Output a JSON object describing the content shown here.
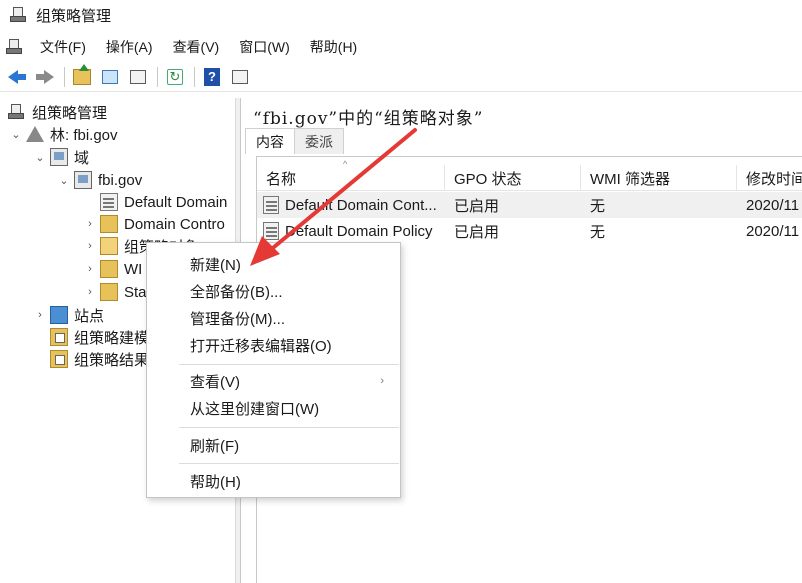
{
  "window": {
    "title": "组策略管理",
    "icon": "mmc-console-icon"
  },
  "menubar": {
    "items": [
      "文件(F)",
      "操作(A)",
      "查看(V)",
      "窗口(W)",
      "帮助(H)"
    ]
  },
  "toolbar": {
    "icons": [
      "back-icon",
      "forward-icon",
      "up-folder-icon",
      "show-hide-tree-icon",
      "properties-icon",
      "refresh-icon",
      "help-icon",
      "action-pane-icon"
    ]
  },
  "tree": {
    "root": "组策略管理",
    "forest": "林: fbi.gov",
    "domains": "域",
    "domain": "fbi.gov",
    "children": [
      "Default Domain",
      "Domain Contro",
      "组策略对象",
      "WI",
      "Sta"
    ],
    "sites": "站点",
    "modeling": "组策略建模",
    "results": "组策略结果"
  },
  "main": {
    "title": "“fbi.gov”中的“组策略对象”",
    "tabs": [
      "内容",
      "委派"
    ],
    "columns": [
      "名称",
      "GPO 状态",
      "WMI 筛选器",
      "修改时间"
    ],
    "rows": [
      {
        "name": "Default Domain Cont...",
        "status": "已启用",
        "wmi": "无",
        "modified": "2020/11"
      },
      {
        "name": "Default Domain Policy",
        "status": "已启用",
        "wmi": "无",
        "modified": "2020/11"
      }
    ]
  },
  "context_menu": {
    "items": [
      "新建(N)",
      "全部备份(B)...",
      "管理备份(M)...",
      "打开迁移表编辑器(O)",
      "查看(V)",
      "从这里创建窗口(W)",
      "刷新(F)",
      "帮助(H)"
    ],
    "submenu_arrow": "›"
  },
  "annotation": {
    "arrow_color": "#e53935"
  }
}
